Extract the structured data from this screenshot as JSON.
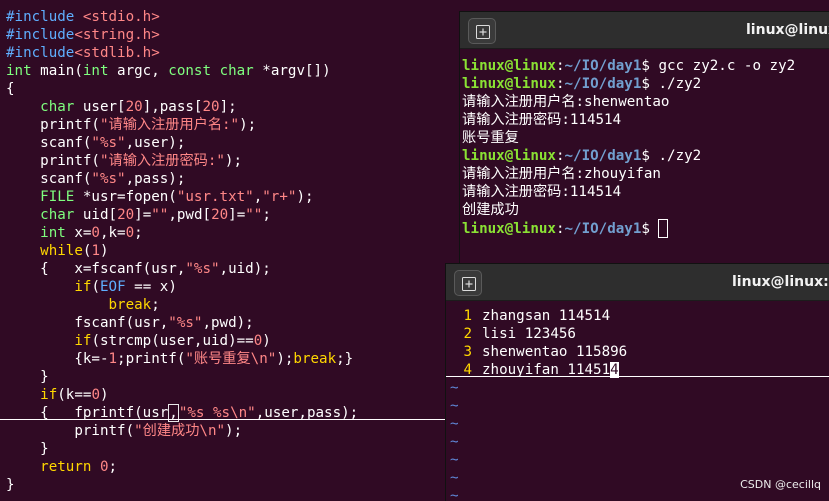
{
  "editor": {
    "lines": [
      [
        [
          "kw-pre",
          "#include "
        ],
        [
          "str",
          "<stdio.h>"
        ]
      ],
      [
        [
          "kw-pre",
          "#include"
        ],
        [
          "str",
          "<string.h>"
        ]
      ],
      [
        [
          "kw-pre",
          "#include"
        ],
        [
          "str",
          "<stdlib.h>"
        ]
      ],
      [
        [
          "kw-type",
          "int"
        ],
        [
          "plain",
          " main("
        ],
        [
          "kw-type",
          "int"
        ],
        [
          "plain",
          " argc, "
        ],
        [
          "kw-type",
          "const"
        ],
        [
          "plain",
          " "
        ],
        [
          "kw-type",
          "char"
        ],
        [
          "plain",
          " *argv[])"
        ]
      ],
      [
        [
          "plain",
          "{"
        ]
      ],
      [
        [
          "plain",
          "    "
        ],
        [
          "kw-type",
          "char"
        ],
        [
          "plain",
          " user["
        ],
        [
          "num",
          "20"
        ],
        [
          "plain",
          "],pass["
        ],
        [
          "num",
          "20"
        ],
        [
          "plain",
          "];"
        ]
      ],
      [
        [
          "plain",
          "    printf("
        ],
        [
          "str",
          "\"请输入注册用户名:\""
        ],
        [
          "plain",
          ");"
        ]
      ],
      [
        [
          "plain",
          "    scanf("
        ],
        [
          "str",
          "\"%s\""
        ],
        [
          "plain",
          ",user);"
        ]
      ],
      [
        [
          "plain",
          "    printf("
        ],
        [
          "str",
          "\"请输入注册密码:\""
        ],
        [
          "plain",
          ");"
        ]
      ],
      [
        [
          "plain",
          "    scanf("
        ],
        [
          "str",
          "\"%s\""
        ],
        [
          "plain",
          ",pass);"
        ]
      ],
      [
        [
          "plain",
          "    "
        ],
        [
          "kw-type",
          "FILE"
        ],
        [
          "plain",
          " *usr=fopen("
        ],
        [
          "str",
          "\"usr.txt\""
        ],
        [
          "plain",
          ","
        ],
        [
          "str",
          "\"r+\""
        ],
        [
          "plain",
          ");"
        ]
      ],
      [
        [
          "plain",
          "    "
        ],
        [
          "kw-type",
          "char"
        ],
        [
          "plain",
          " uid["
        ],
        [
          "num",
          "20"
        ],
        [
          "plain",
          "]="
        ],
        [
          "str",
          "\"\""
        ],
        [
          "plain",
          ",pwd["
        ],
        [
          "num",
          "20"
        ],
        [
          "plain",
          "]="
        ],
        [
          "str",
          "\"\""
        ],
        [
          "plain",
          ";"
        ]
      ],
      [
        [
          "plain",
          "    "
        ],
        [
          "kw-type",
          "int"
        ],
        [
          "plain",
          " x="
        ],
        [
          "num",
          "0"
        ],
        [
          "plain",
          ",k="
        ],
        [
          "num",
          "0"
        ],
        [
          "plain",
          ";"
        ]
      ],
      [
        [
          "plain",
          "    "
        ],
        [
          "kw-ctrl",
          "while"
        ],
        [
          "plain",
          "("
        ],
        [
          "num",
          "1"
        ],
        [
          "plain",
          ")"
        ]
      ],
      [
        [
          "plain",
          "    {   x=fscanf(usr,"
        ],
        [
          "str",
          "\"%s\""
        ],
        [
          "plain",
          ",uid);"
        ]
      ],
      [
        [
          "plain",
          "        "
        ],
        [
          "kw-ctrl",
          "if"
        ],
        [
          "plain",
          "("
        ],
        [
          "kw-pre",
          "EOF"
        ],
        [
          "plain",
          " == x)"
        ]
      ],
      [
        [
          "plain",
          "            "
        ],
        [
          "kw-ctrl",
          "break"
        ],
        [
          "plain",
          ";"
        ]
      ],
      [
        [
          "plain",
          "        fscanf(usr,"
        ],
        [
          "str",
          "\"%s\""
        ],
        [
          "plain",
          ",pwd);"
        ]
      ],
      [
        [
          "plain",
          "        "
        ],
        [
          "kw-ctrl",
          "if"
        ],
        [
          "plain",
          "(strcmp(user,uid)=="
        ],
        [
          "num",
          "0"
        ],
        [
          "plain",
          ")"
        ]
      ],
      [
        [
          "plain",
          "        {k=-"
        ],
        [
          "num",
          "1"
        ],
        [
          "plain",
          ";printf("
        ],
        [
          "str",
          "\"账号重复\\n\""
        ],
        [
          "plain",
          ");"
        ],
        [
          "kw-ctrl",
          "break"
        ],
        [
          "plain",
          ";}"
        ]
      ],
      [
        [
          "plain",
          "    }"
        ]
      ],
      [
        [
          "plain",
          "    "
        ],
        [
          "kw-ctrl",
          "if"
        ],
        [
          "plain",
          "(k=="
        ],
        [
          "num",
          "0"
        ],
        [
          "plain",
          ")"
        ]
      ],
      [
        [
          "plain",
          "    {   fprintf(usr"
        ],
        [
          "cursor",
          ","
        ],
        [
          "str",
          "\"%s %s\\n\""
        ],
        [
          "plain",
          ",user,pass);"
        ]
      ],
      [
        [
          "plain",
          "        printf("
        ],
        [
          "str",
          "\"创建成功\\n\""
        ],
        [
          "plain",
          ");"
        ]
      ],
      [
        [
          "plain",
          "    }"
        ]
      ],
      [
        [
          "plain",
          "    "
        ],
        [
          "kw-ctrl",
          "return"
        ],
        [
          "plain",
          " "
        ],
        [
          "num",
          "0"
        ],
        [
          "plain",
          ";"
        ]
      ],
      [
        [
          "plain",
          "}"
        ]
      ]
    ]
  },
  "terminal1": {
    "title": "linux@linux",
    "lines": [
      {
        "user": "linux@linux",
        "path": "~/IO/day1",
        "cmd": "gcc zy2.c -o zy2"
      },
      {
        "user": "linux@linux",
        "path": "~/IO/day1",
        "cmd": "./zy2"
      },
      {
        "text": "请输入注册用户名:shenwentao"
      },
      {
        "text": "请输入注册密码:114514"
      },
      {
        "text": "账号重复"
      },
      {
        "user": "linux@linux",
        "path": "~/IO/day1",
        "cmd": "./zy2"
      },
      {
        "text": "请输入注册用户名:zhouyifan"
      },
      {
        "text": "请输入注册密码:114514"
      },
      {
        "text": "创建成功"
      },
      {
        "user": "linux@linux",
        "path": "~/IO/day1",
        "cmd": "",
        "cursor": true
      }
    ]
  },
  "terminal2": {
    "title": "linux@linux: ~",
    "vim_lines": [
      {
        "num": "1",
        "text": "zhangsan 114514"
      },
      {
        "num": "2",
        "text": "lisi 123456"
      },
      {
        "num": "3",
        "text": "shenwentao 115896"
      },
      {
        "num": "4",
        "text": "zhouyifan 11451",
        "cursor_char": "4"
      }
    ],
    "tildes": [
      "~",
      "~",
      "~",
      "~",
      "~",
      "~",
      "~"
    ]
  },
  "icons": {
    "new_tab": "new-tab-icon"
  },
  "watermark": "CSDN @cecillq",
  "colors": {
    "background": "#300a24",
    "prompt_user": "#8ae234",
    "prompt_path": "#729fcf",
    "titlebar": "#2e2e2e"
  }
}
